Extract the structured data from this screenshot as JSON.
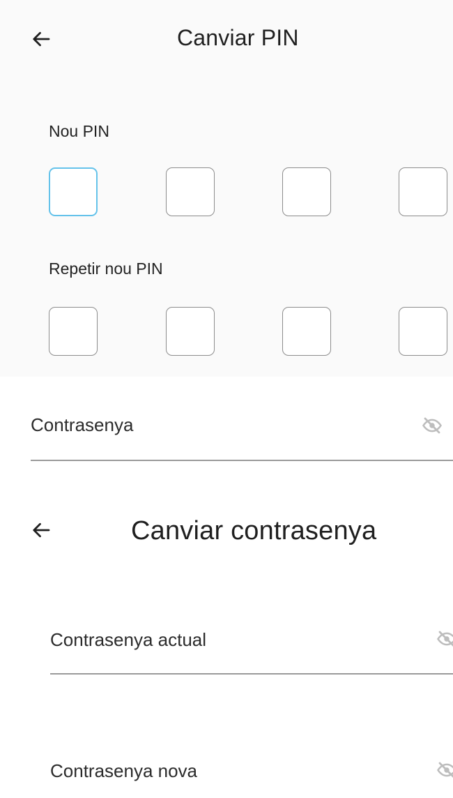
{
  "change_pin": {
    "title": "Canviar PIN",
    "new_pin_label": "Nou PIN",
    "repeat_pin_label": "Repetir nou PIN",
    "digits_per_pin": 4
  },
  "password_field": {
    "label": "Contrasenya",
    "visibility_icon": "eye-off-icon"
  },
  "change_password": {
    "title": "Canviar contrasenya",
    "current_label": "Contrasenya actual",
    "new_label": "Contrasenya nova",
    "visibility_icon": "eye-off-icon"
  },
  "colors": {
    "active_border": "#64c2ea",
    "box_border": "#8c8c8c",
    "icon_gray": "#bdbdbd"
  }
}
